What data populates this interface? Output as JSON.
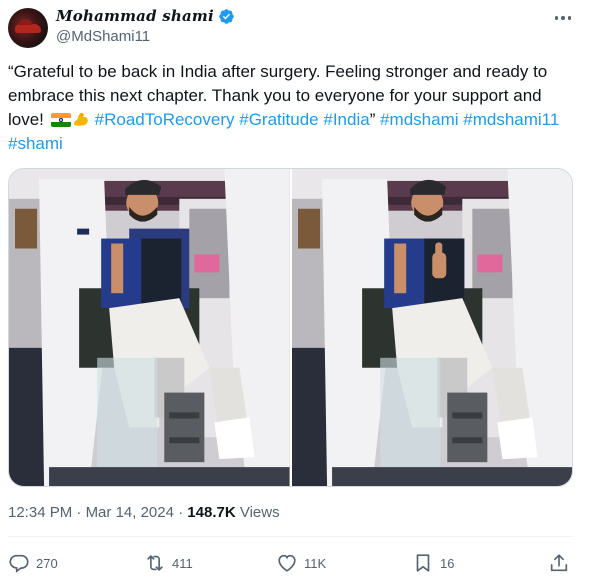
{
  "author": {
    "display_name": "Mohammad shami",
    "handle": "@MdShami11",
    "verified": true
  },
  "tweet": {
    "text_part1": "“Grateful to be back in India after surgery. Feeling stronger and ready to embrace this next chapter. Thank you to everyone for your support and love! ",
    "emojis": [
      "flag-india",
      "flexed-biceps"
    ],
    "hashtags_inline": [
      "#RoadToRecovery",
      "#Gratitude",
      "#India"
    ],
    "closing_quote": "”",
    "hashtags_trailing": [
      "#mdshami",
      "#mdshami11",
      "#shami"
    ]
  },
  "meta": {
    "time": "12:34 PM",
    "separator": "·",
    "date": "Mar 14, 2024",
    "views_count": "148.7K",
    "views_label": "Views"
  },
  "actions": {
    "replies": "270",
    "reposts": "411",
    "likes": "11K",
    "bookmarks": "16"
  },
  "icons": {
    "verified": "verified-badge-icon",
    "more": "more-options-icon",
    "reply": "reply-icon",
    "repost": "repost-icon",
    "like": "heart-icon",
    "bookmark": "bookmark-icon",
    "share": "share-icon"
  },
  "colors": {
    "link": "#1d9bf0",
    "secondary_text": "#536471",
    "primary_text": "#0f1419"
  }
}
